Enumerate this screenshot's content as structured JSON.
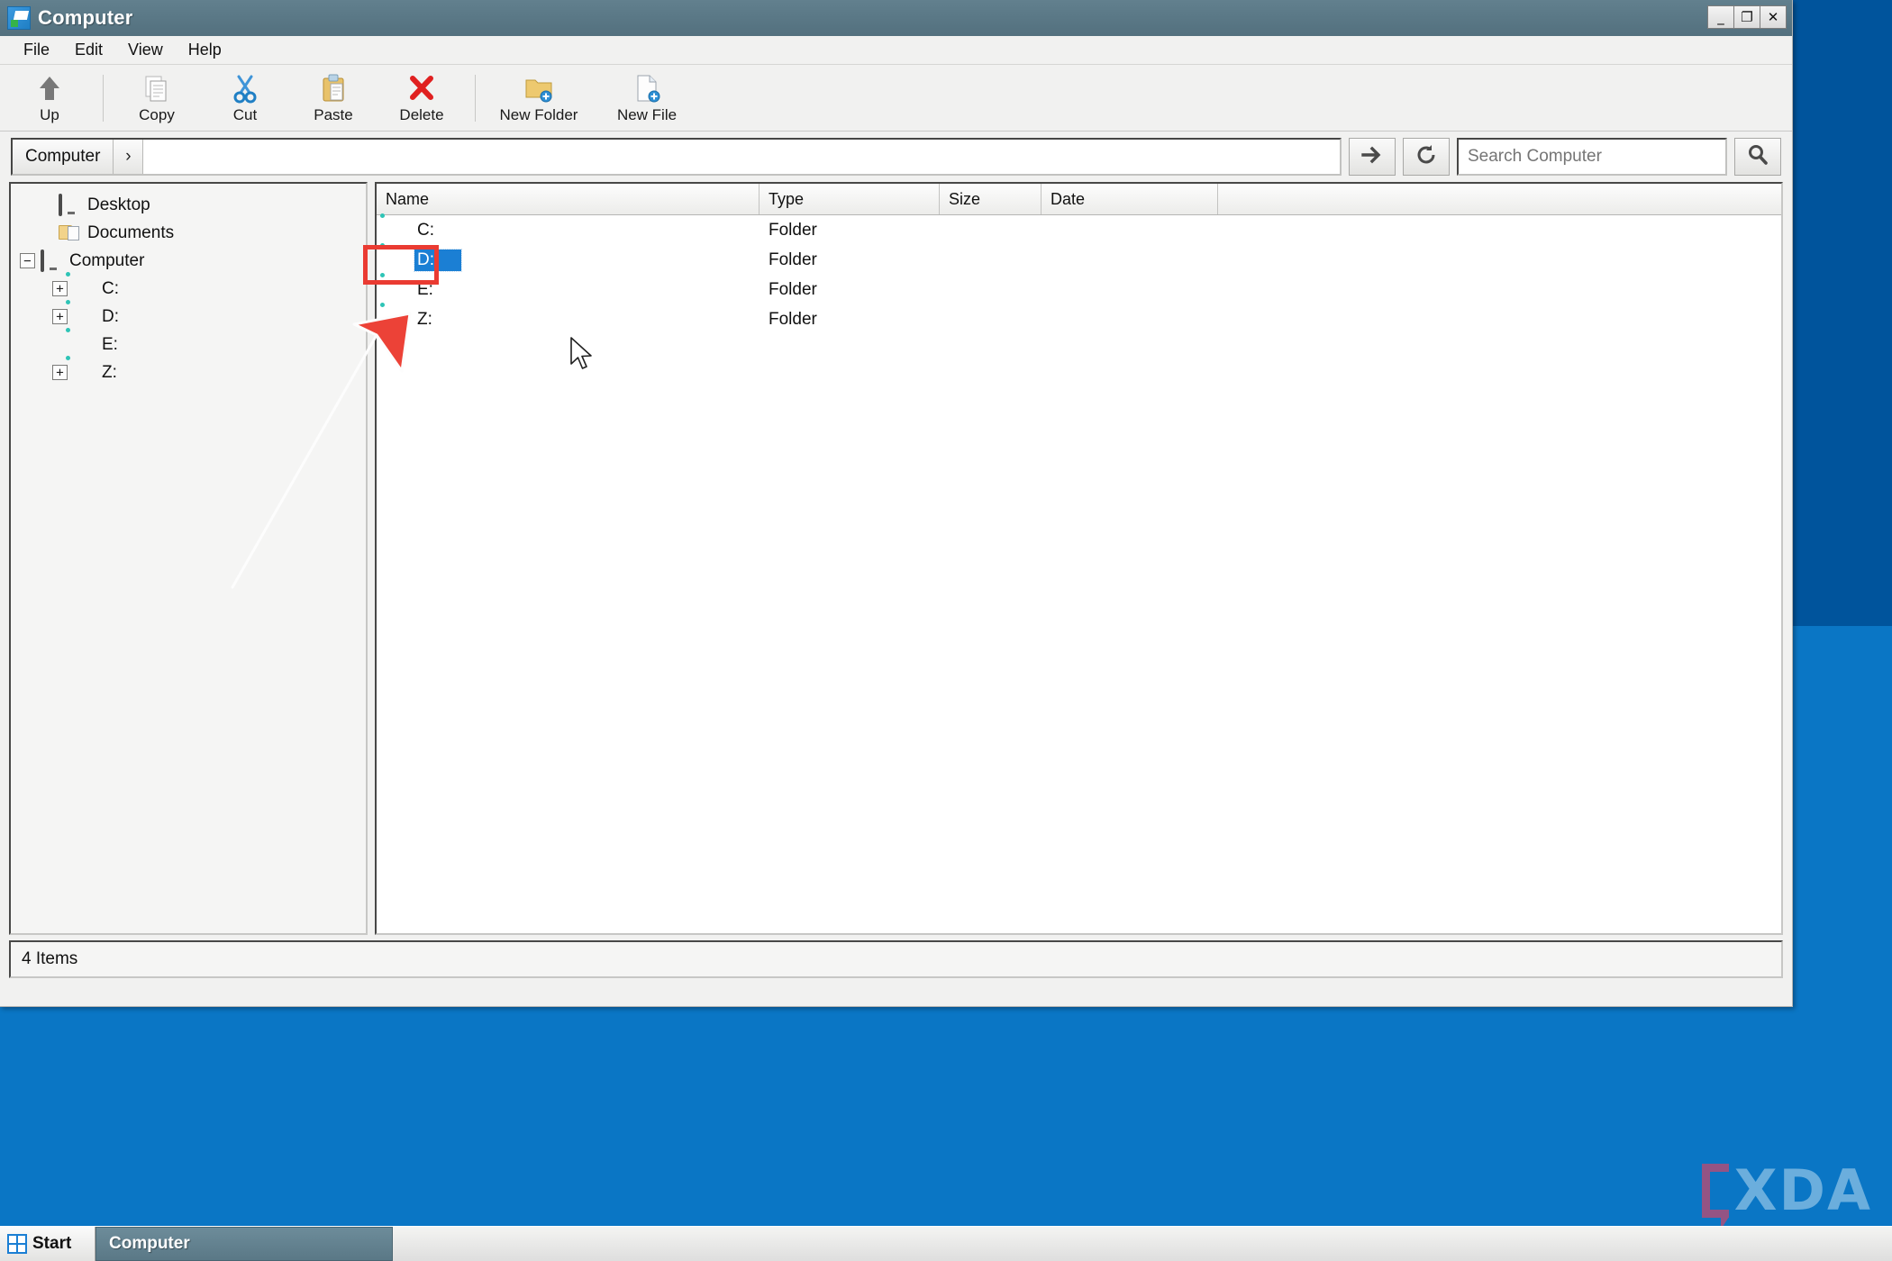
{
  "window": {
    "title": "Computer",
    "icon": "computer-window-icon",
    "controls": [
      {
        "name": "minimize-button",
        "glyph": "_"
      },
      {
        "name": "maximize-button",
        "glyph": "❐"
      },
      {
        "name": "close-button",
        "glyph": "✕"
      }
    ]
  },
  "menubar": {
    "items": [
      {
        "label": "File"
      },
      {
        "label": "Edit"
      },
      {
        "label": "View"
      },
      {
        "label": "Help"
      }
    ]
  },
  "toolbar": {
    "buttons": [
      {
        "label": "Up",
        "icon": "up-arrow-icon"
      },
      {
        "label": "Copy",
        "icon": "copy-document-icon"
      },
      {
        "label": "Cut",
        "icon": "scissors-icon"
      },
      {
        "label": "Paste",
        "icon": "clipboard-paste-icon"
      },
      {
        "label": "Delete",
        "icon": "red-x-delete-icon"
      },
      {
        "label": "New Folder",
        "icon": "new-folder-icon"
      },
      {
        "label": "New File",
        "icon": "new-file-icon"
      }
    ]
  },
  "addressbar": {
    "breadcrumb": "Computer",
    "breadcrumb_arrow": "›",
    "path_value": "",
    "go_icon": "right-arrow-go-icon",
    "refresh_icon": "refresh-icon",
    "search_placeholder": "Search Computer",
    "search_value": "",
    "search_icon": "magnifier-search-icon"
  },
  "sidebar": {
    "items": [
      {
        "label": "Desktop",
        "icon": "monitor-icon",
        "indent": 1,
        "expander": ""
      },
      {
        "label": "Documents",
        "icon": "documents-folder-icon",
        "indent": 1,
        "expander": ""
      },
      {
        "label": "Computer",
        "icon": "monitor-icon",
        "indent": 0,
        "expander": "−"
      },
      {
        "label": "C:",
        "icon": "drive-icon",
        "indent": 2,
        "expander": "+"
      },
      {
        "label": "D:",
        "icon": "drive-icon",
        "indent": 2,
        "expander": "+"
      },
      {
        "label": "E:",
        "icon": "drive-icon",
        "indent": 2,
        "expander": ""
      },
      {
        "label": "Z:",
        "icon": "drive-icon",
        "indent": 2,
        "expander": "+"
      }
    ]
  },
  "filelist": {
    "columns": [
      {
        "label": "Name"
      },
      {
        "label": "Type"
      },
      {
        "label": "Size"
      },
      {
        "label": "Date"
      },
      {
        "label": ""
      }
    ],
    "rows": [
      {
        "name": "C:",
        "type": "Folder",
        "size": "",
        "date": "",
        "icon": "drive-icon",
        "selected": false
      },
      {
        "name": "D:",
        "type": "Folder",
        "size": "",
        "date": "",
        "icon": "drive-icon",
        "selected": true
      },
      {
        "name": "E:",
        "type": "Folder",
        "size": "",
        "date": "",
        "icon": "drive-icon",
        "selected": false
      },
      {
        "name": "Z:",
        "type": "Folder",
        "size": "",
        "date": "",
        "icon": "drive-icon",
        "selected": false
      }
    ]
  },
  "statusbar": {
    "text": "4 Items"
  },
  "taskbar": {
    "start_label": "Start",
    "task_label": "Computer"
  },
  "watermark": {
    "text": "XDA"
  },
  "annotations": {
    "highlight_target": "D:",
    "arrow_color": "#ea3b32",
    "box_color": "#ea3b32"
  },
  "colors": {
    "titlebar": "#5a7886",
    "selection": "#1b7fd4",
    "desktop_top": "#00549c",
    "desktop_bottom": "#0a76c5",
    "annotation_red": "#ea3b32"
  }
}
